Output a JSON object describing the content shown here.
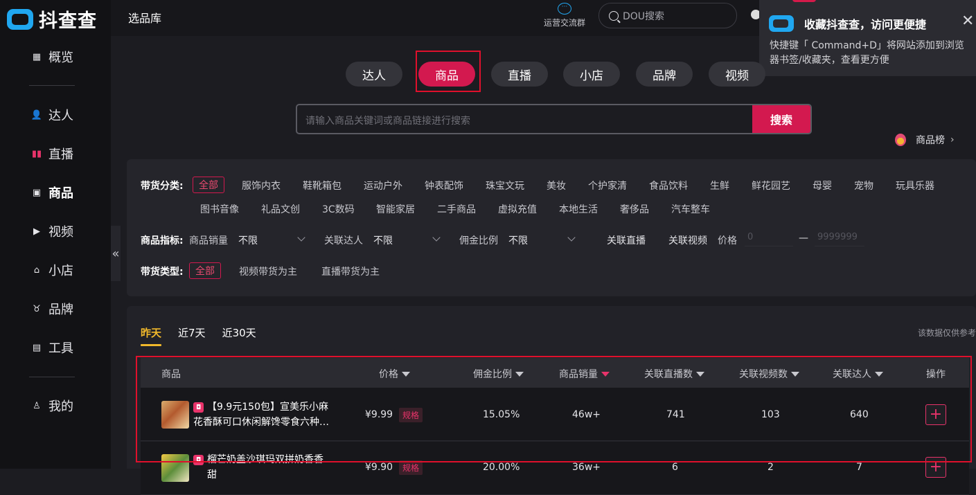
{
  "brand": {
    "name": "抖查查"
  },
  "sidebar": {
    "items": [
      {
        "label": "概览",
        "icon": "grid-icon"
      },
      {
        "label": "达人",
        "icon": "user-group-icon"
      },
      {
        "label": "直播",
        "icon": "bar-chart-icon"
      },
      {
        "label": "商品",
        "icon": "bag-icon"
      },
      {
        "label": "视频",
        "icon": "play-icon"
      },
      {
        "label": "小店",
        "icon": "store-icon"
      },
      {
        "label": "品牌",
        "icon": "brand-icon"
      },
      {
        "label": "工具",
        "icon": "toolbox-icon"
      },
      {
        "label": "我的",
        "icon": "person-icon"
      }
    ],
    "collapse_glyph": "«"
  },
  "topbar": {
    "title": "选品库",
    "ops_label": "运营交流群",
    "search_placeholder": "DOU搜索"
  },
  "popup": {
    "title": "收藏抖查查，访问更便捷",
    "desc": "快捷键「 Command+D」将网站添加到浏览器书签/收藏夹，查看更方便",
    "close": "✕"
  },
  "category_tabs": [
    "达人",
    "商品",
    "直播",
    "小店",
    "品牌",
    "视频"
  ],
  "search": {
    "placeholder": "请输入商品关键词或商品链接进行搜索",
    "button": "搜索"
  },
  "rank_link": "商品榜",
  "filters": {
    "category_label": "带货分类:",
    "categories_row1": [
      "全部",
      "服饰内衣",
      "鞋靴箱包",
      "运动户外",
      "钟表配饰",
      "珠宝文玩",
      "美妆",
      "个护家清",
      "食品饮料",
      "生鲜",
      "鲜花园艺",
      "母婴",
      "宠物",
      "玩具乐器"
    ],
    "categories_row2": [
      "图书音像",
      "礼品文创",
      "3C数码",
      "智能家居",
      "二手商品",
      "虚拟充值",
      "本地生活",
      "奢侈品",
      "汽车整车"
    ],
    "metric_label": "商品指标:",
    "metrics": [
      {
        "name": "商品销量",
        "value": "不限"
      },
      {
        "name": "关联达人",
        "value": "不限"
      },
      {
        "name": "佣金比例",
        "value": "不限"
      }
    ],
    "toggles": [
      "关联直播",
      "关联视频"
    ],
    "price_label": "价格",
    "price_min": "0",
    "price_dash": "—",
    "price_max": "9999999",
    "type_label": "带货类型:",
    "types": [
      "全部",
      "视频带货为主",
      "直播带货为主"
    ]
  },
  "period_tabs": [
    "昨天",
    "近7天",
    "近30天"
  ],
  "note": "该数据仅供参考",
  "table": {
    "headers": [
      "商品",
      "价格",
      "佣金比例",
      "商品销量",
      "关联直播数",
      "关联视频数",
      "关联达人",
      "操作"
    ],
    "rows": [
      {
        "name_line1": "【9.9元150包】宣美乐小麻",
        "name_line2": "花香酥可口休闲解馋零食六种口...",
        "price": "¥9.99",
        "spec": "规格",
        "commission": "15.05%",
        "sales": "46w+",
        "live": "741",
        "video": "103",
        "creators": "640",
        "action": "+"
      },
      {
        "name_line1": "榴芒奶盖沙琪玛双拼奶香香甜",
        "name_line2": "",
        "price": "¥9.90",
        "spec": "规格",
        "commission": "20.00%",
        "sales": "36w+",
        "live": "6",
        "video": "2",
        "creators": "7",
        "action": "+"
      }
    ]
  }
}
